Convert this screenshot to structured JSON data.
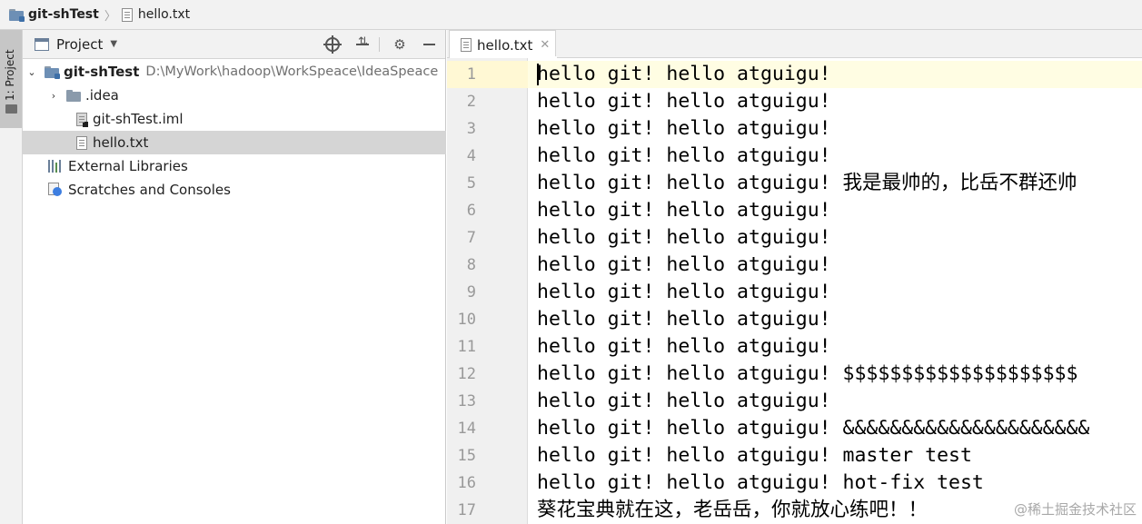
{
  "breadcrumb": {
    "project": "git-shTest",
    "file": "hello.txt"
  },
  "toolstrip": {
    "project_tab": "1: Project"
  },
  "project_panel": {
    "title": "Project",
    "tree": [
      {
        "label": "git-shTest",
        "path": "D:\\MyWork\\hadoop\\WorkSpeace\\IdeaSpeace"
      },
      {
        "label": ".idea"
      },
      {
        "label": "git-shTest.iml"
      },
      {
        "label": "hello.txt"
      },
      {
        "label": "External Libraries"
      },
      {
        "label": "Scratches and Consoles"
      }
    ]
  },
  "editor": {
    "tab_label": "hello.txt",
    "lines": [
      {
        "num": "1",
        "text": "hello git! hello atguigu!"
      },
      {
        "num": "2",
        "text": "hello git! hello atguigu!"
      },
      {
        "num": "3",
        "text": "hello git! hello atguigu!"
      },
      {
        "num": "4",
        "text": "hello git! hello atguigu!"
      },
      {
        "num": "5",
        "text": "hello git! hello atguigu! 我是最帅的，比岳不群还帅"
      },
      {
        "num": "6",
        "text": "hello git! hello atguigu!"
      },
      {
        "num": "7",
        "text": "hello git! hello atguigu!"
      },
      {
        "num": "8",
        "text": "hello git! hello atguigu!"
      },
      {
        "num": "9",
        "text": "hello git! hello atguigu!"
      },
      {
        "num": "10",
        "text": "hello git! hello atguigu!"
      },
      {
        "num": "11",
        "text": "hello git! hello atguigu!"
      },
      {
        "num": "12",
        "text": "hello git! hello atguigu! $$$$$$$$$$$$$$$$$$$$"
      },
      {
        "num": "13",
        "text": "hello git! hello atguigu!"
      },
      {
        "num": "14",
        "text": "hello git! hello atguigu! &&&&&&&&&&&&&&&&&&&&&"
      },
      {
        "num": "15",
        "text": "hello git! hello atguigu! master test"
      },
      {
        "num": "16",
        "text": "hello git! hello atguigu! hot-fix test"
      },
      {
        "num": "17",
        "text": "葵花宝典就在这，老岳岳，你就放心练吧！！"
      }
    ]
  },
  "watermark": "@稀土掘金技术社区"
}
